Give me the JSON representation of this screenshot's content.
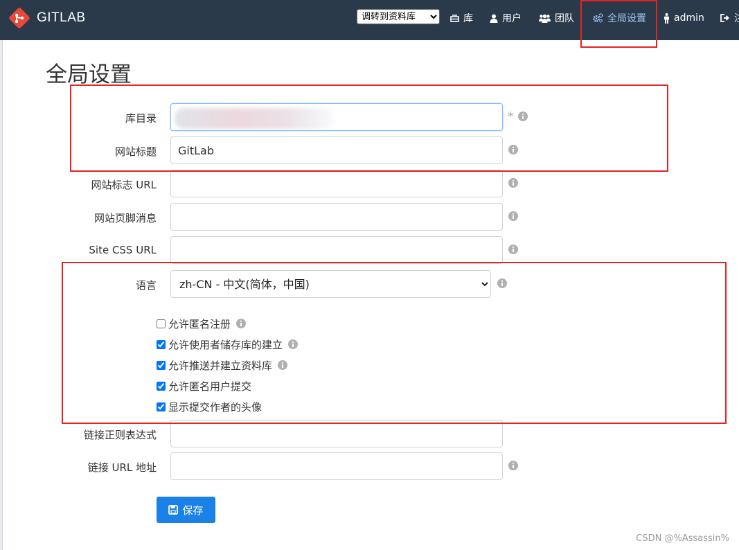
{
  "navbar": {
    "brand": "GITLAB",
    "repo_select": {
      "selected": "调转到资料库"
    },
    "items": [
      {
        "label": "库",
        "icon": "repo-icon"
      },
      {
        "label": "用户",
        "icon": "user-icon"
      },
      {
        "label": "团队",
        "icon": "team-icon"
      },
      {
        "label": "全局设置",
        "icon": "cogs-icon",
        "active": true
      },
      {
        "label": "admin",
        "icon": "male-icon"
      },
      {
        "label": "注",
        "icon": "sign-out-icon"
      }
    ]
  },
  "page": {
    "title": "全局设置"
  },
  "form": {
    "repo_dir": {
      "label": "库目录",
      "value": "",
      "required_mark": "*"
    },
    "site_title": {
      "label": "网站标题",
      "value": "GitLab"
    },
    "site_logo_url": {
      "label": "网站标志 URL",
      "value": ""
    },
    "site_footer": {
      "label": "网站页脚消息",
      "value": ""
    },
    "site_css_url": {
      "label": "Site CSS URL",
      "value": ""
    },
    "language": {
      "label": "语言",
      "selected": "zh-CN - 中文(简体，中国)"
    },
    "checkboxes": [
      {
        "label": "允许匿名注册",
        "checked": false,
        "has_info": true
      },
      {
        "label": "允许使用者储存库的建立",
        "checked": true,
        "has_info": true
      },
      {
        "label": "允许推送并建立资料库",
        "checked": true,
        "has_info": true
      },
      {
        "label": "允许匿名用户提交",
        "checked": true,
        "has_info": false
      },
      {
        "label": "显示提交作者的头像",
        "checked": true,
        "has_info": false
      }
    ],
    "link_regex": {
      "label": "链接正则表达式",
      "value": ""
    },
    "link_url": {
      "label": "链接 URL 地址",
      "value": ""
    },
    "save_label": "保存"
  },
  "watermark": "CSDN @%Assassin%",
  "colors": {
    "navbar_bg": "#2b3a4a",
    "active_nav": "#9fc7f0",
    "primary": "#1a82e6",
    "highlight": "#e5231f"
  }
}
